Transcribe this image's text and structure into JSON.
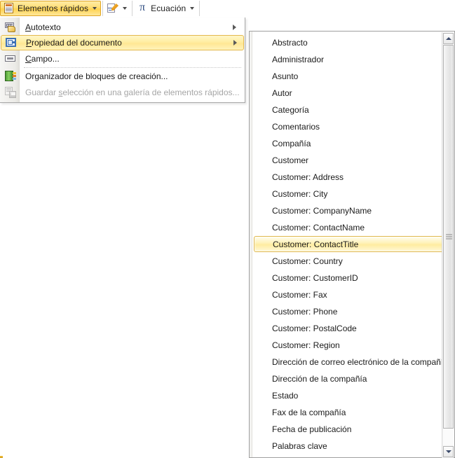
{
  "ribbon": {
    "buttons": [
      {
        "id": "quick-parts",
        "label": "Elementos rápidos",
        "icon": "quick-parts-icon",
        "has_caret": true,
        "active": true
      },
      {
        "id": "signature-line",
        "label": "",
        "icon": "signature-pen-icon",
        "has_caret": true,
        "active": false
      },
      {
        "id": "equation",
        "label": "Ecuación",
        "icon": "pi-equation-icon",
        "has_caret": true,
        "active": false
      }
    ]
  },
  "menu": {
    "items": [
      {
        "label": "Autotexto",
        "accel": "A",
        "icon": "autotext-icon",
        "submenu": true,
        "disabled": false,
        "selected": false
      },
      {
        "label": "Propiedad del documento",
        "accel": "P",
        "icon": "document-property-icon",
        "submenu": true,
        "disabled": false,
        "selected": true
      },
      {
        "label": "Campo...",
        "accel": "C",
        "icon": "field-icon",
        "submenu": false,
        "disabled": false,
        "selected": false
      },
      {
        "label": "Organizador de bloques de creación...",
        "accel": "g",
        "icon": "building-blocks-organizer-icon",
        "submenu": false,
        "disabled": false,
        "selected": false
      },
      {
        "label": "Guardar selección en una galería de elementos rápidos...",
        "accel": "s",
        "icon": "save-selection-icon",
        "submenu": false,
        "disabled": true,
        "selected": false
      }
    ]
  },
  "submenu": {
    "selected_index": 12,
    "items": [
      "Abstracto",
      "Administrador",
      "Asunto",
      "Autor",
      "Categoría",
      "Comentarios",
      "Compañía",
      "Customer",
      "Customer: Address",
      "Customer: City",
      "Customer: CompanyName",
      "Customer: ContactName",
      "Customer: ContactTitle",
      "Customer: Country",
      "Customer: CustomerID",
      "Customer: Fax",
      "Customer: Phone",
      "Customer: PostalCode",
      "Customer: Region",
      "Dirección de correo electrónico de la compañía",
      "Dirección de la compañía",
      "Estado",
      "Fax de la compañía",
      "Fecha de publicación",
      "Palabras clave"
    ],
    "scrollbar": {
      "up_arrow": "scroll-up-icon",
      "down_arrow": "scroll-down-icon",
      "thumb_grip": "scrollbar-grip"
    }
  },
  "colors": {
    "highlight_border": "#e0b84c",
    "highlight_fill": "#ffeca0",
    "menu_gutter": "#ecebe7",
    "text": "#1a1a1a",
    "disabled_text": "#a6a6a6"
  }
}
